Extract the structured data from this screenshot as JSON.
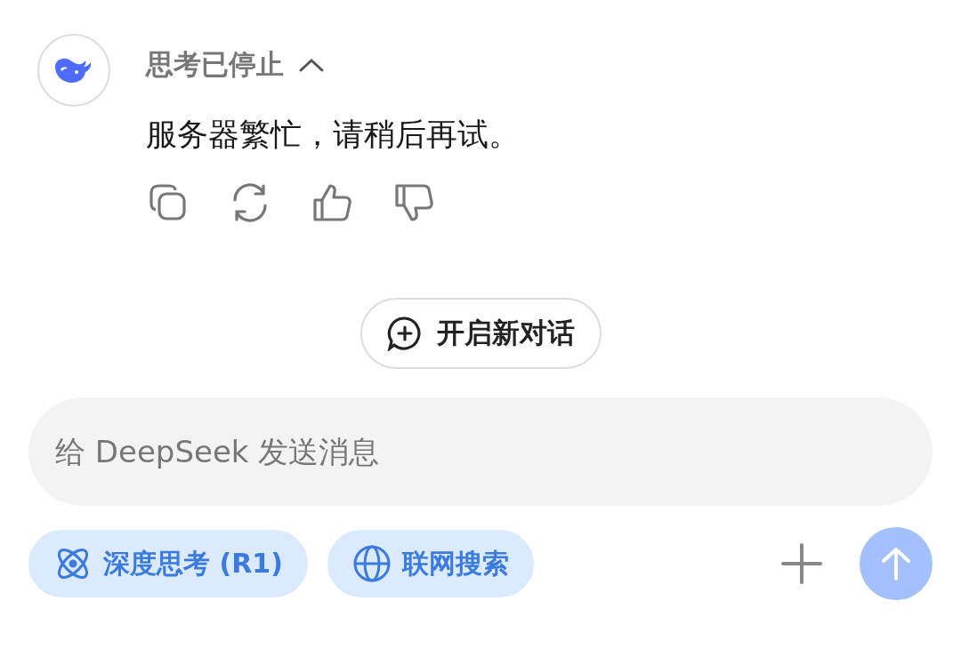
{
  "message": {
    "thinking_status": "思考已停止",
    "thinking_expanded": true,
    "text": "服务器繁忙，请稍后再试。"
  },
  "new_chat_button": "开启新对话",
  "composer": {
    "placeholder": "给 DeepSeek 发送消息",
    "send_disabled": true
  },
  "toggles": [
    {
      "kind": "deep-think",
      "label": "深度思考 (R1)",
      "selected": true
    },
    {
      "kind": "web-search",
      "label": "联网搜索",
      "selected": true
    }
  ]
}
